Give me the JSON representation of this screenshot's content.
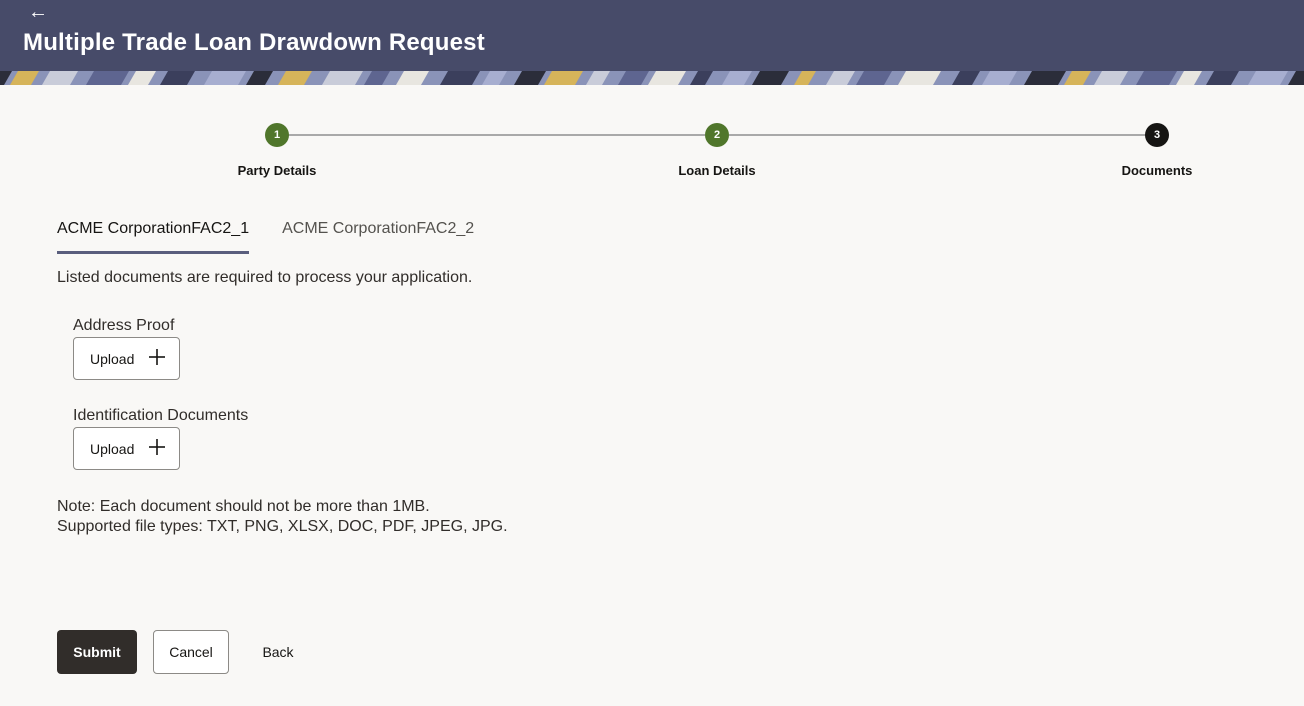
{
  "header": {
    "title": "Multiple Trade Loan Drawdown Request",
    "back_icon": "arrow-left-icon"
  },
  "stepper": {
    "steps": [
      {
        "number": "1",
        "label": "Party Details",
        "state": "done"
      },
      {
        "number": "2",
        "label": "Loan Details",
        "state": "done"
      },
      {
        "number": "3",
        "label": "Documents",
        "state": "active"
      }
    ],
    "done_color": "#50762b",
    "active_color": "#161513"
  },
  "tabs": [
    {
      "label": "ACME CorporationFAC2_1",
      "selected": true
    },
    {
      "label": "ACME CorporationFAC2_2",
      "selected": false
    }
  ],
  "intro_text": "Listed documents are required to process your application.",
  "documents": [
    {
      "label": "Address Proof",
      "button_label": "Upload",
      "icon": "plus-icon"
    },
    {
      "label": "Identification Documents",
      "button_label": "Upload",
      "icon": "plus-icon"
    }
  ],
  "note": {
    "line1": "Note: Each document should not be more than 1MB.",
    "line2": "Supported file types: TXT, PNG, XLSX, DOC, PDF, JPEG, JPG."
  },
  "actions": {
    "submit_label": "Submit",
    "cancel_label": "Cancel",
    "back_label": "Back"
  },
  "colors": {
    "header_bg": "#474b69",
    "primary_button": "#312d2a"
  }
}
